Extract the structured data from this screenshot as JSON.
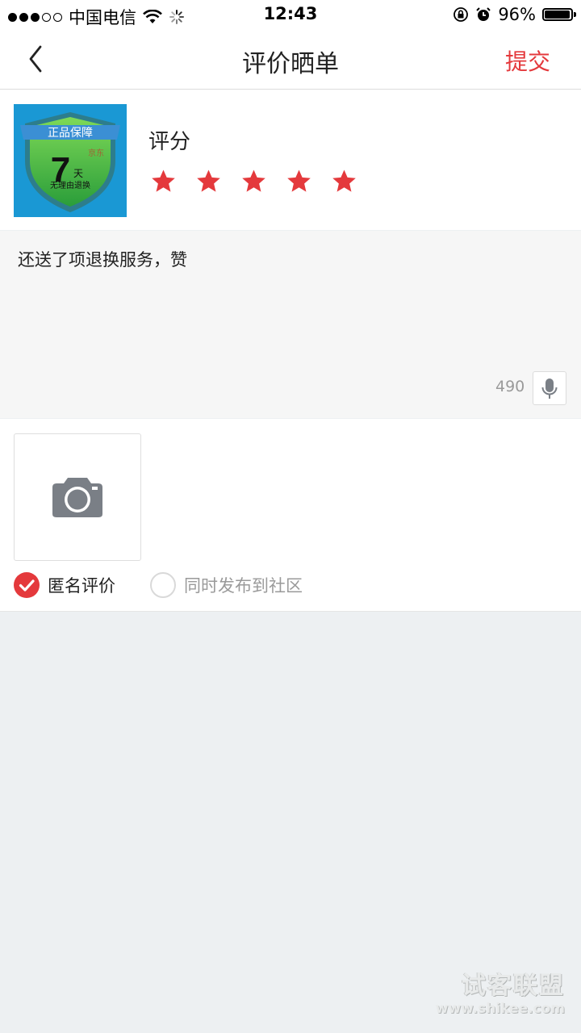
{
  "status_bar": {
    "carrier": "中国电信",
    "time": "12:43",
    "battery_percent": "96%",
    "battery_level": 0.96,
    "signal_bars_filled": 3,
    "signal_bars_total": 5
  },
  "nav": {
    "title": "评价晒单",
    "back_icon": "chevron-left-icon",
    "submit_label": "提交"
  },
  "product": {
    "badge_top": "正品保障",
    "badge_number": "7",
    "badge_unit": "天",
    "badge_bottom": "无理由退换",
    "badge_faint": "京东",
    "rating_label": "评分",
    "rating_value": 5,
    "rating_max": 5,
    "star_color": "#e4393c"
  },
  "review": {
    "text": "还送了项退换服务，赞",
    "char_remaining": "490",
    "mic_icon": "microphone-icon"
  },
  "photo": {
    "icon": "camera-icon"
  },
  "options": {
    "anonymous_label": "匿名评价",
    "anonymous_checked": true,
    "community_label": "同时发布到社区",
    "community_checked": false
  },
  "watermark": {
    "name": "试客联盟",
    "url": "www.shikee.com"
  },
  "colors": {
    "accent": "#e4393c",
    "background": "#edf0f2"
  }
}
